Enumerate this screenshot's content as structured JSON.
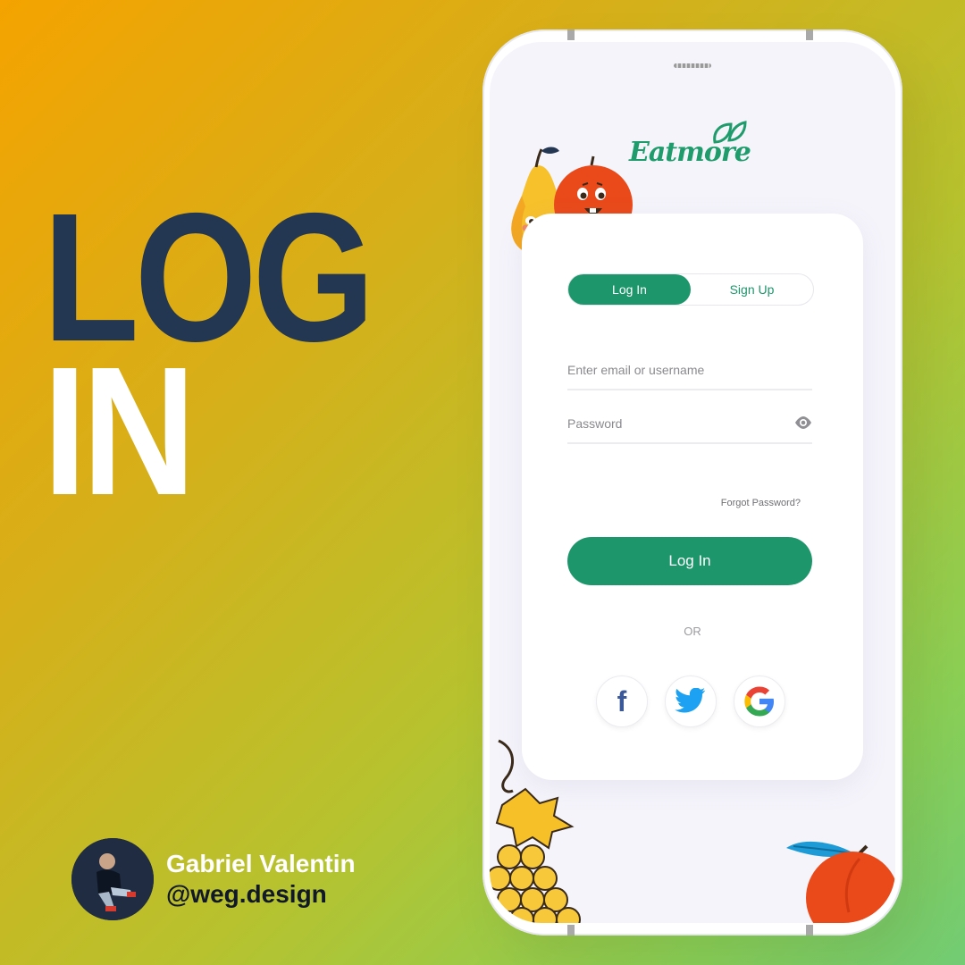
{
  "headline": {
    "line1": "LOG",
    "line2": "IN"
  },
  "author": {
    "name": "Gabriel Valentin",
    "handle": "@weg.design"
  },
  "app": {
    "logo": "Eatmore",
    "tabs": [
      {
        "label": "Log In",
        "active": true
      },
      {
        "label": "Sign Up",
        "active": false
      }
    ],
    "email": {
      "placeholder": "Enter email or username",
      "value": ""
    },
    "password": {
      "placeholder": "Password",
      "value": ""
    },
    "forgot_label": "Forgot Password?",
    "login_label": "Log In",
    "or_label": "OR",
    "social": [
      {
        "name": "facebook",
        "glyph": "f"
      },
      {
        "name": "twitter",
        "icon": "twitter-bird-icon"
      },
      {
        "name": "google",
        "glyph": "G"
      }
    ]
  },
  "colors": {
    "brand_green": "#1e966b",
    "headline_navy": "#243752",
    "facebook": "#3b5998",
    "twitter": "#1da1f2"
  }
}
